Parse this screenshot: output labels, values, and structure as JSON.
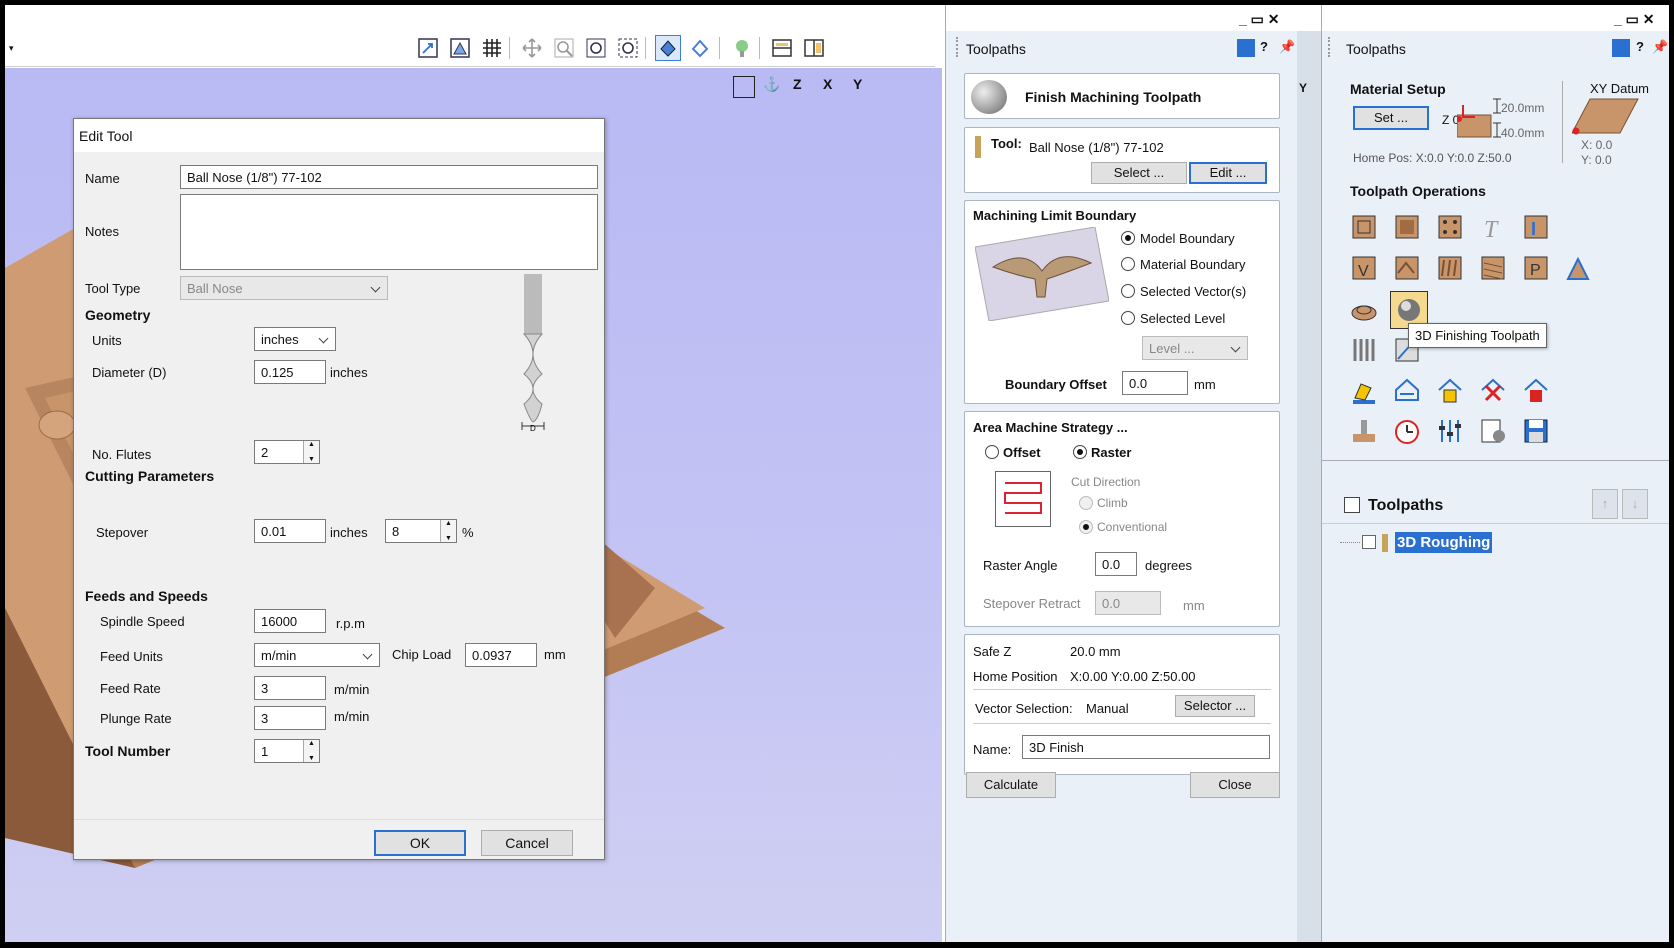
{
  "toolbar": {
    "icons": [
      "zoom-window-icon",
      "zoom-selected-icon",
      "grid-icon",
      "pan-icon",
      "zoom-icon",
      "zoom-extents-icon",
      "zoom-all-icon",
      "render-icon",
      "shaded-icon",
      "lighting-icon",
      "split-icon",
      "layout-icon"
    ]
  },
  "viewport": {
    "axes": [
      "Z",
      "X",
      "Y"
    ],
    "axis_label": "Y"
  },
  "dialog": {
    "title": "Edit Tool",
    "name_label": "Name",
    "name_value": "Ball Nose (1/8\") 77-102",
    "notes_label": "Notes",
    "tool_type_label": "Tool Type",
    "tool_type_value": "Ball Nose",
    "geometry_header": "Geometry",
    "units_label": "Units",
    "units_value": "inches",
    "diameter_label": "Diameter (D)",
    "diameter_value": "0.125",
    "diameter_unit": "inches",
    "flutes_label": "No. Flutes",
    "flutes_value": "2",
    "diagram_label": "D",
    "cutting_header": "Cutting Parameters",
    "stepover_label": "Stepover",
    "stepover_value": "0.01",
    "stepover_unit": "inches",
    "stepover_pct": "8",
    "pct_sign": "%",
    "feeds_header": "Feeds and Speeds",
    "spindle_label": "Spindle Speed",
    "spindle_value": "16000",
    "spindle_unit": "r.p.m",
    "feed_units_label": "Feed Units",
    "feed_units_value": "m/min",
    "chip_load_label": "Chip Load",
    "chip_load_value": "0.0937",
    "chip_load_unit": "mm",
    "feed_rate_label": "Feed Rate",
    "feed_rate_value": "3",
    "feed_rate_unit": "m/min",
    "plunge_rate_label": "Plunge Rate",
    "plunge_rate_value": "3",
    "plunge_rate_unit": "m/min",
    "tool_number_label": "Tool Number",
    "tool_number_value": "1",
    "ok": "OK",
    "cancel": "Cancel"
  },
  "mid": {
    "panel_title": "Toolpaths",
    "header": "Finish Machining Toolpath",
    "tool_label": "Tool:",
    "tool_value": "Ball Nose (1/8\") 77-102",
    "select_btn": "Select ...",
    "edit_btn": "Edit ...",
    "mlb_header": "Machining Limit Boundary",
    "opt_model": "Model Boundary",
    "opt_material": "Material Boundary",
    "opt_vectors": "Selected Vector(s)",
    "opt_level": "Selected Level",
    "level_combo": "Level ...",
    "boundary_offset_label": "Boundary Offset",
    "boundary_offset_value": "0.0",
    "boundary_offset_unit": "mm",
    "ams_header": "Area Machine Strategy ...",
    "offset": "Offset",
    "raster": "Raster",
    "cut_direction": "Cut Direction",
    "climb": "Climb",
    "conventional": "Conventional",
    "raster_angle_label": "Raster Angle",
    "raster_angle_value": "0.0",
    "raster_angle_unit": "degrees",
    "stepover_retract_label": "Stepover Retract",
    "stepover_retract_value": "0.0",
    "stepover_retract_unit": "mm",
    "safe_z_label": "Safe Z",
    "safe_z_value": "20.0 mm",
    "home_label": "Home Position",
    "home_value": "X:0.00 Y:0.00 Z:50.00",
    "vector_sel_label": "Vector Selection:",
    "vector_sel_value": "Manual",
    "selector_btn": "Selector ...",
    "name_label": "Name:",
    "name_value": "3D Finish",
    "calculate": "Calculate",
    "close": "Close"
  },
  "right": {
    "panel_title": "Toolpaths",
    "material_setup": "Material Setup",
    "set_btn": "Set ...",
    "z0": "Z 0",
    "dim1": "20.0mm",
    "dim2": "40.0mm",
    "home_pos": "Home Pos:  X:0.0 Y:0.0 Z:50.0",
    "xy_datum": "XY Datum",
    "datum_x": "X: 0.0",
    "datum_y": "Y: 0.0",
    "ops_header": "Toolpath Operations",
    "tooltip": "3D Finishing Toolpath",
    "list_header": "Toolpaths",
    "list_item": "3D Roughing",
    "window_controls": "_ ▭ ✕"
  },
  "colors": {
    "accent": "#2a70d0",
    "wood": "#c8946a",
    "panel": "#e9f0f8"
  }
}
